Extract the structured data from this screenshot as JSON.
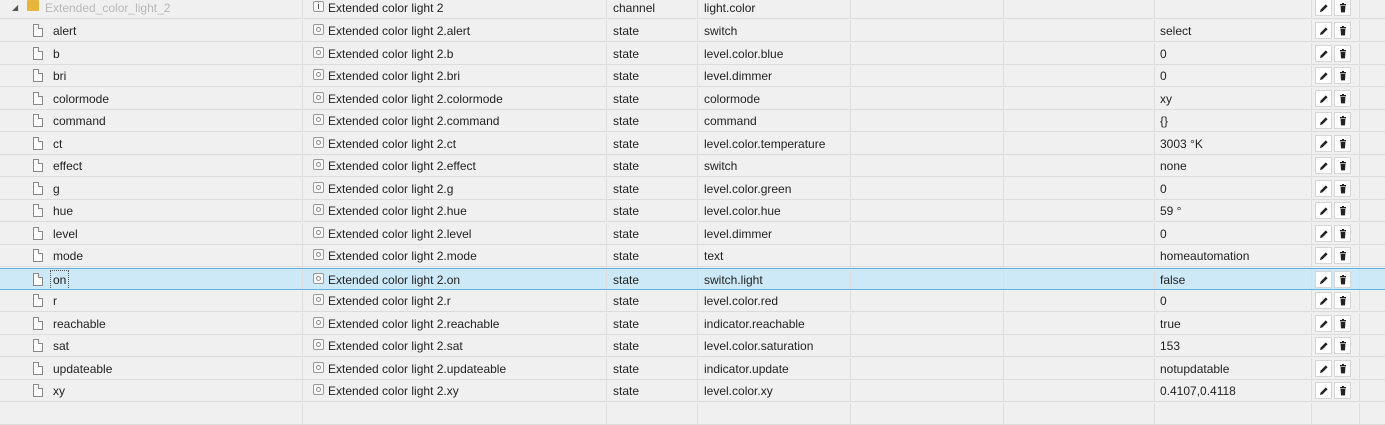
{
  "channel": {
    "id": "Extended_color_light_2",
    "name": "Extended color light 2",
    "type": "channel",
    "role": "light.color",
    "value": ""
  },
  "rows": [
    {
      "id": "alert",
      "name": "Extended color light 2.alert",
      "type": "state",
      "role": "switch",
      "value": "select"
    },
    {
      "id": "b",
      "name": "Extended color light 2.b",
      "type": "state",
      "role": "level.color.blue",
      "value": "0"
    },
    {
      "id": "bri",
      "name": "Extended color light 2.bri",
      "type": "state",
      "role": "level.dimmer",
      "value": "0"
    },
    {
      "id": "colormode",
      "name": "Extended color light 2.colormode",
      "type": "state",
      "role": "colormode",
      "value": "xy"
    },
    {
      "id": "command",
      "name": "Extended color light 2.command",
      "type": "state",
      "role": "command",
      "value": "{}"
    },
    {
      "id": "ct",
      "name": "Extended color light 2.ct",
      "type": "state",
      "role": "level.color.temperature",
      "value": "3003 °K"
    },
    {
      "id": "effect",
      "name": "Extended color light 2.effect",
      "type": "state",
      "role": "switch",
      "value": "none"
    },
    {
      "id": "g",
      "name": "Extended color light 2.g",
      "type": "state",
      "role": "level.color.green",
      "value": "0"
    },
    {
      "id": "hue",
      "name": "Extended color light 2.hue",
      "type": "state",
      "role": "level.color.hue",
      "value": "59 °"
    },
    {
      "id": "level",
      "name": "Extended color light 2.level",
      "type": "state",
      "role": "level.dimmer",
      "value": "0"
    },
    {
      "id": "mode",
      "name": "Extended color light 2.mode",
      "type": "state",
      "role": "text",
      "value": "homeautomation"
    },
    {
      "id": "on",
      "name": "Extended color light 2.on",
      "type": "state",
      "role": "switch.light",
      "value": "false",
      "selected": true
    },
    {
      "id": "r",
      "name": "Extended color light 2.r",
      "type": "state",
      "role": "level.color.red",
      "value": "0"
    },
    {
      "id": "reachable",
      "name": "Extended color light 2.reachable",
      "type": "state",
      "role": "indicator.reachable",
      "value": "true"
    },
    {
      "id": "sat",
      "name": "Extended color light 2.sat",
      "type": "state",
      "role": "level.color.saturation",
      "value": "153"
    },
    {
      "id": "updateable",
      "name": "Extended color light 2.updateable",
      "type": "state",
      "role": "indicator.update",
      "value": "notupdatable"
    },
    {
      "id": "xy",
      "name": "Extended color light 2.xy",
      "type": "state",
      "role": "level.color.xy",
      "value": "0.4107,0.4118"
    }
  ],
  "icons": {
    "edit": "pencil-icon",
    "delete": "trash-icon",
    "file": "file-icon",
    "folder": "folder-icon",
    "state": "state-icon",
    "channel": "channel-icon"
  },
  "colors": {
    "selection_bg": "#cde8f6",
    "selection_border": "#5fb2e2",
    "folder": "#e8b53c"
  }
}
